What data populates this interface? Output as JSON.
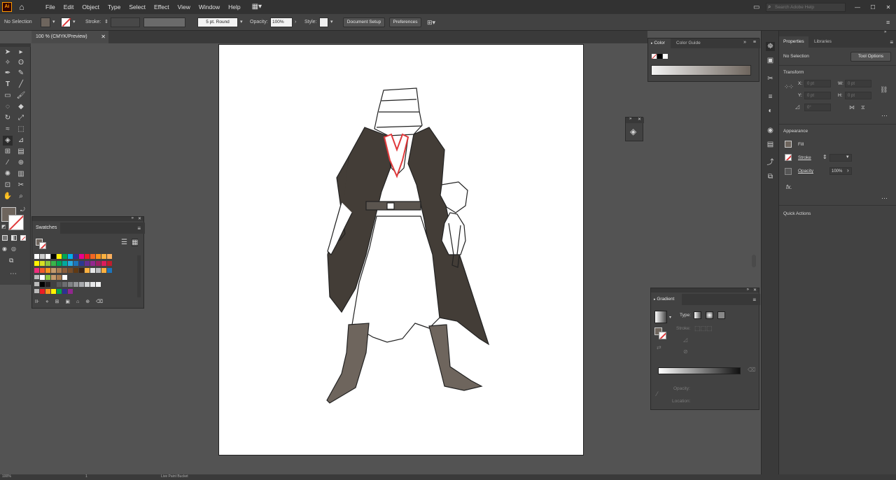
{
  "app": {
    "logo": "Ai",
    "search_placeholder": "Search Adobe Help"
  },
  "menu": [
    "File",
    "Edit",
    "Object",
    "Type",
    "Select",
    "Effect",
    "View",
    "Window",
    "Help"
  ],
  "control_bar": {
    "selection": "No Selection",
    "stroke_label": "Stroke:",
    "brush": "5 pt. Round",
    "opacity_label": "Opacity:",
    "opacity_value": "100%",
    "style_label": "Style:",
    "document_setup": "Document Setup",
    "preferences": "Preferences"
  },
  "document_tab": {
    "title": "100 % (CMYK/Preview)"
  },
  "swatches_panel": {
    "title": "Swatches"
  },
  "color_panel": {
    "tab_color": "Color",
    "tab_guide": "Color Guide"
  },
  "gradient_panel": {
    "title": "Gradient",
    "type_label": "Type:",
    "stroke_label": "Stroke:",
    "opacity_label": "Opacity:",
    "location_label": "Location:"
  },
  "properties": {
    "tab_properties": "Properties",
    "tab_libraries": "Libraries",
    "no_selection": "No Selection",
    "tool_options": "Tool Options",
    "transform": "Transform",
    "x_label": "X:",
    "y_label": "Y:",
    "w_label": "W:",
    "h_label": "H:",
    "x_val": "0 pt",
    "y_val": "0 pt",
    "w_val": "0 pt",
    "h_val": "0 pt",
    "angle_val": "0°",
    "appearance": "Appearance",
    "fill": "Fill",
    "stroke": "Stroke",
    "opacity": "Opacity",
    "opacity_value": "100%",
    "fx": "fx.",
    "quick_actions": "Quick Actions"
  },
  "status": {
    "zoom": "100%",
    "page": "1",
    "tool": "Live Paint Bucket"
  },
  "colors": {
    "accent_red": "#e0393b",
    "panel_bg": "#424242",
    "fill_brown": "#6e655d"
  }
}
